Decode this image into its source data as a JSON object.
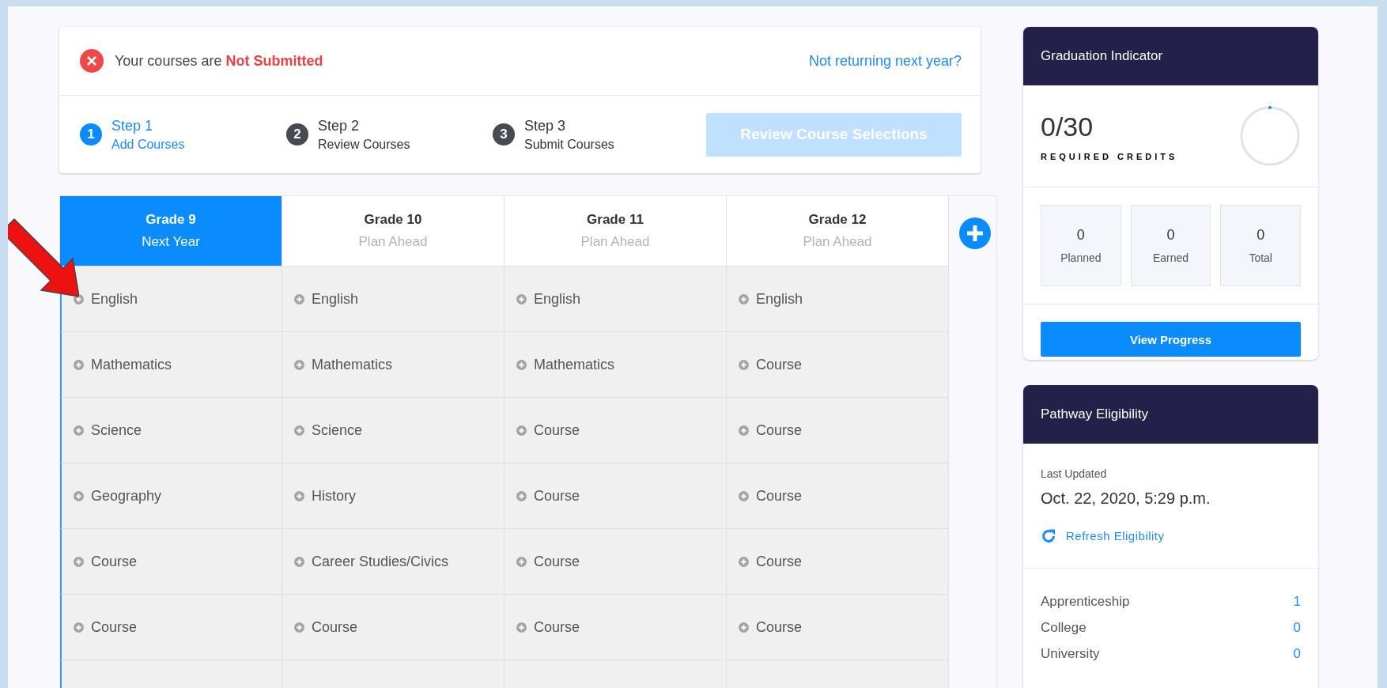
{
  "status": {
    "message": "Your courses are **Not Submitted**",
    "link": "Not returning next year?"
  },
  "steps": [
    {
      "number": "1",
      "title": "Step 1",
      "label": "Add Courses",
      "selected": true
    },
    {
      "number": "2",
      "title": "Step 2",
      "label": "Review Courses",
      "selected": false
    },
    {
      "number": "3",
      "title": "Step 3",
      "label": "Submit Courses",
      "selected": false
    }
  ],
  "review_button": {
    "label": "Review Course Selections",
    "disabled": true
  },
  "grades": [
    {
      "title": "Grade 9",
      "subtitle": "Next Year",
      "selected": true,
      "courses": [
        "English",
        "Mathematics",
        "Science",
        "Geography",
        "Course",
        "Course"
      ]
    },
    {
      "title": "Grade 10",
      "subtitle": "Plan Ahead",
      "selected": false,
      "courses": [
        "English",
        "Mathematics",
        "Science",
        "History",
        "Career Studies/Civics",
        "Course"
      ]
    },
    {
      "title": "Grade 11",
      "subtitle": "Plan Ahead",
      "selected": false,
      "courses": [
        "English",
        "Mathematics",
        "Course",
        "Course",
        "Course",
        "Course"
      ]
    },
    {
      "title": "Grade 12",
      "subtitle": "Plan Ahead",
      "selected": false,
      "courses": [
        "English",
        "Course",
        "Course",
        "Course",
        "Course",
        "Course"
      ]
    }
  ],
  "graduation": {
    "title": "Graduation Indicator",
    "credits": "0/30",
    "credits_label": "REQUIRED CREDITS",
    "level": 0,
    "stats": [
      {
        "value": "0",
        "label": "Planned"
      },
      {
        "value": "0",
        "label": "Earned"
      },
      {
        "value": "0",
        "label": "Total"
      }
    ],
    "button": "View Progress"
  },
  "pathway": {
    "title": "Pathway Eligibility",
    "updated_label": "Last Updated",
    "updated": "Oct. 22, 2020, 5:29 p.m.",
    "refresh": "Refresh Eligibility",
    "items": [
      {
        "name": "Apprenticeship",
        "count": "1"
      },
      {
        "name": "College",
        "count": "0"
      },
      {
        "name": "University",
        "count": "0"
      }
    ]
  }
}
